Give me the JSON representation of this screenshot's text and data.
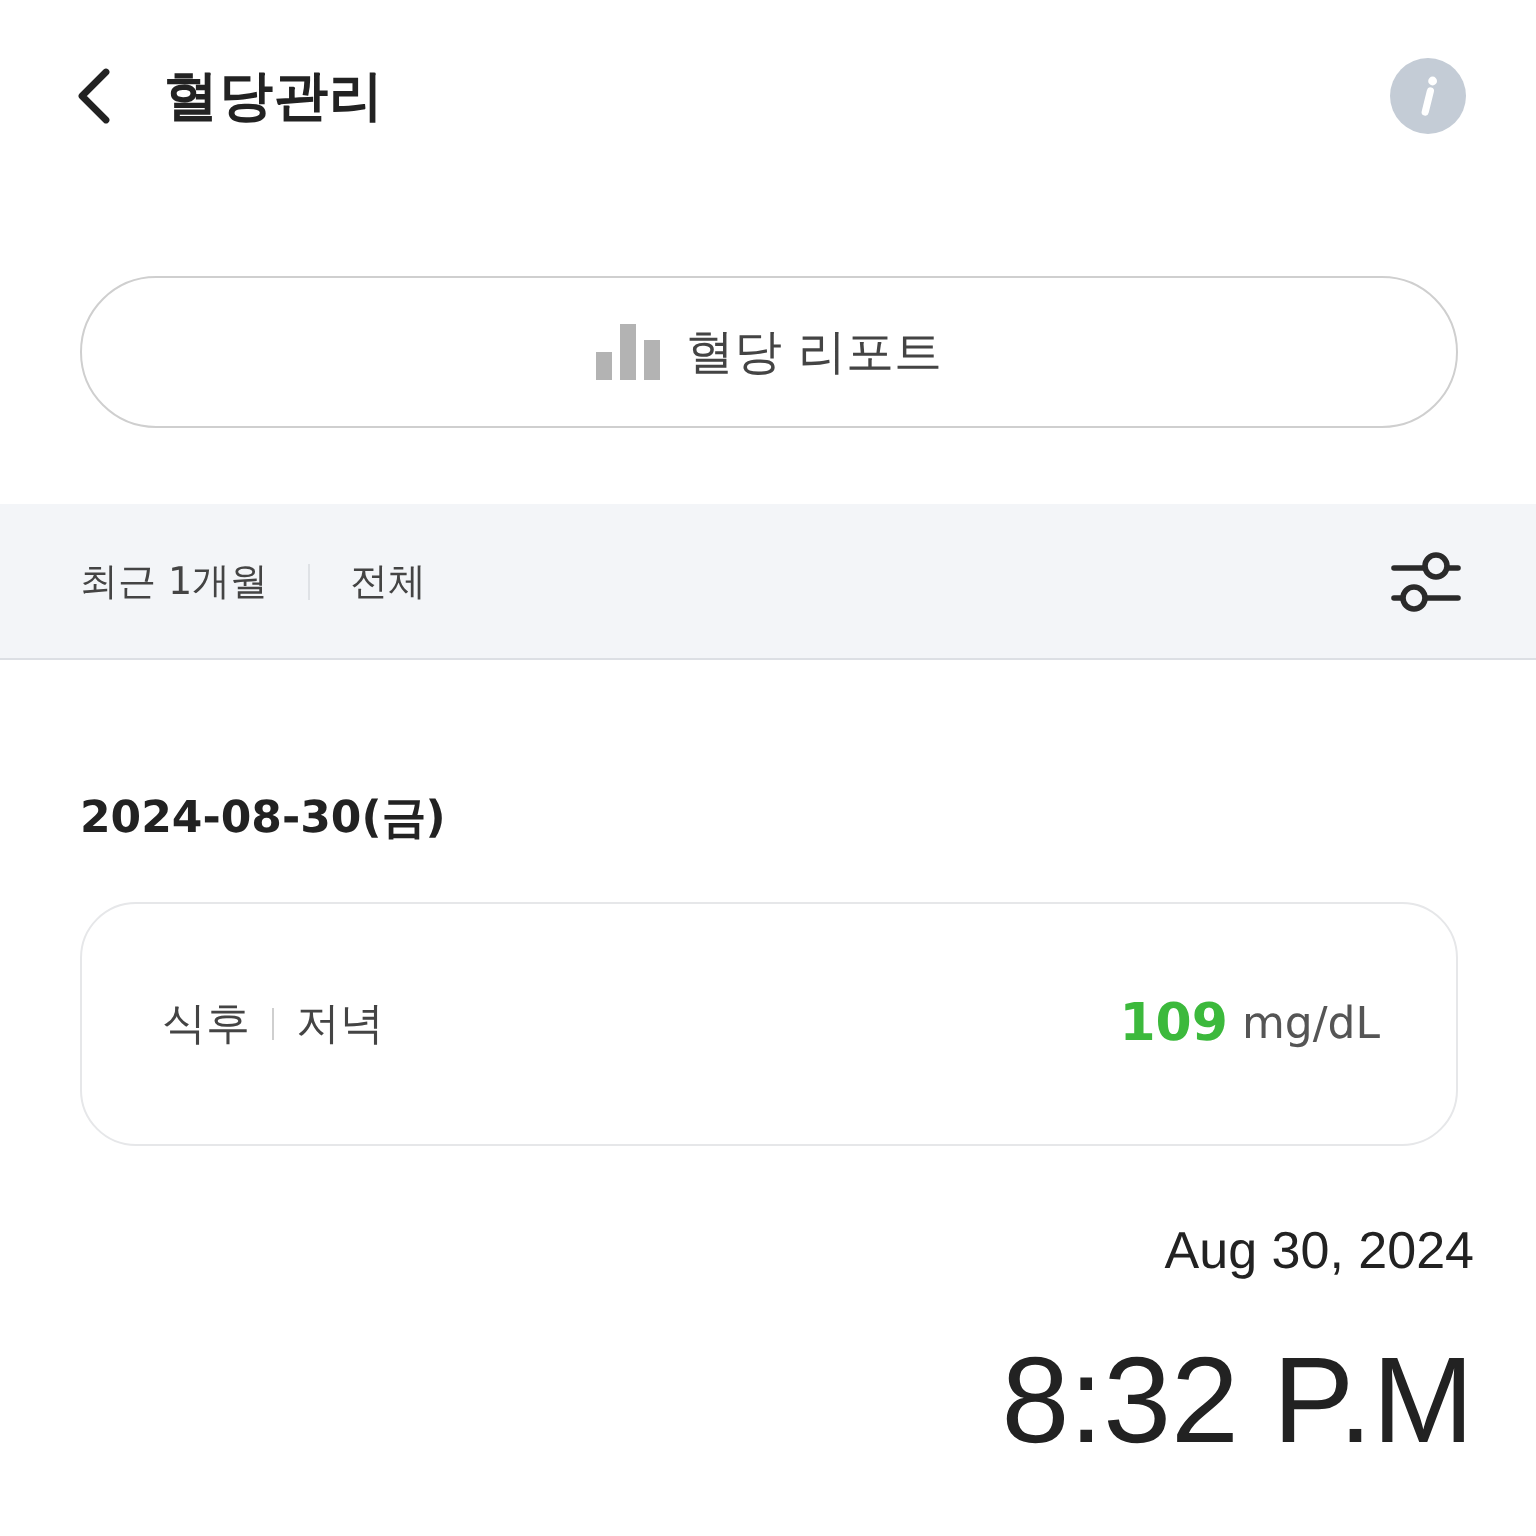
{
  "header": {
    "title": "혈당관리"
  },
  "report_button": {
    "label": "혈당 리포트"
  },
  "filter_bar": {
    "filters": [
      "최근 1개월",
      "전체"
    ]
  },
  "records": [
    {
      "date": "2024-08-30(금)",
      "entries": [
        {
          "timing": "식후",
          "meal": "저녁",
          "value": "109",
          "unit": "mg/dL",
          "color": "#3cb93c"
        }
      ]
    }
  ],
  "timestamp": {
    "date": "Aug 30, 2024",
    "time": "8:32 P.M"
  }
}
